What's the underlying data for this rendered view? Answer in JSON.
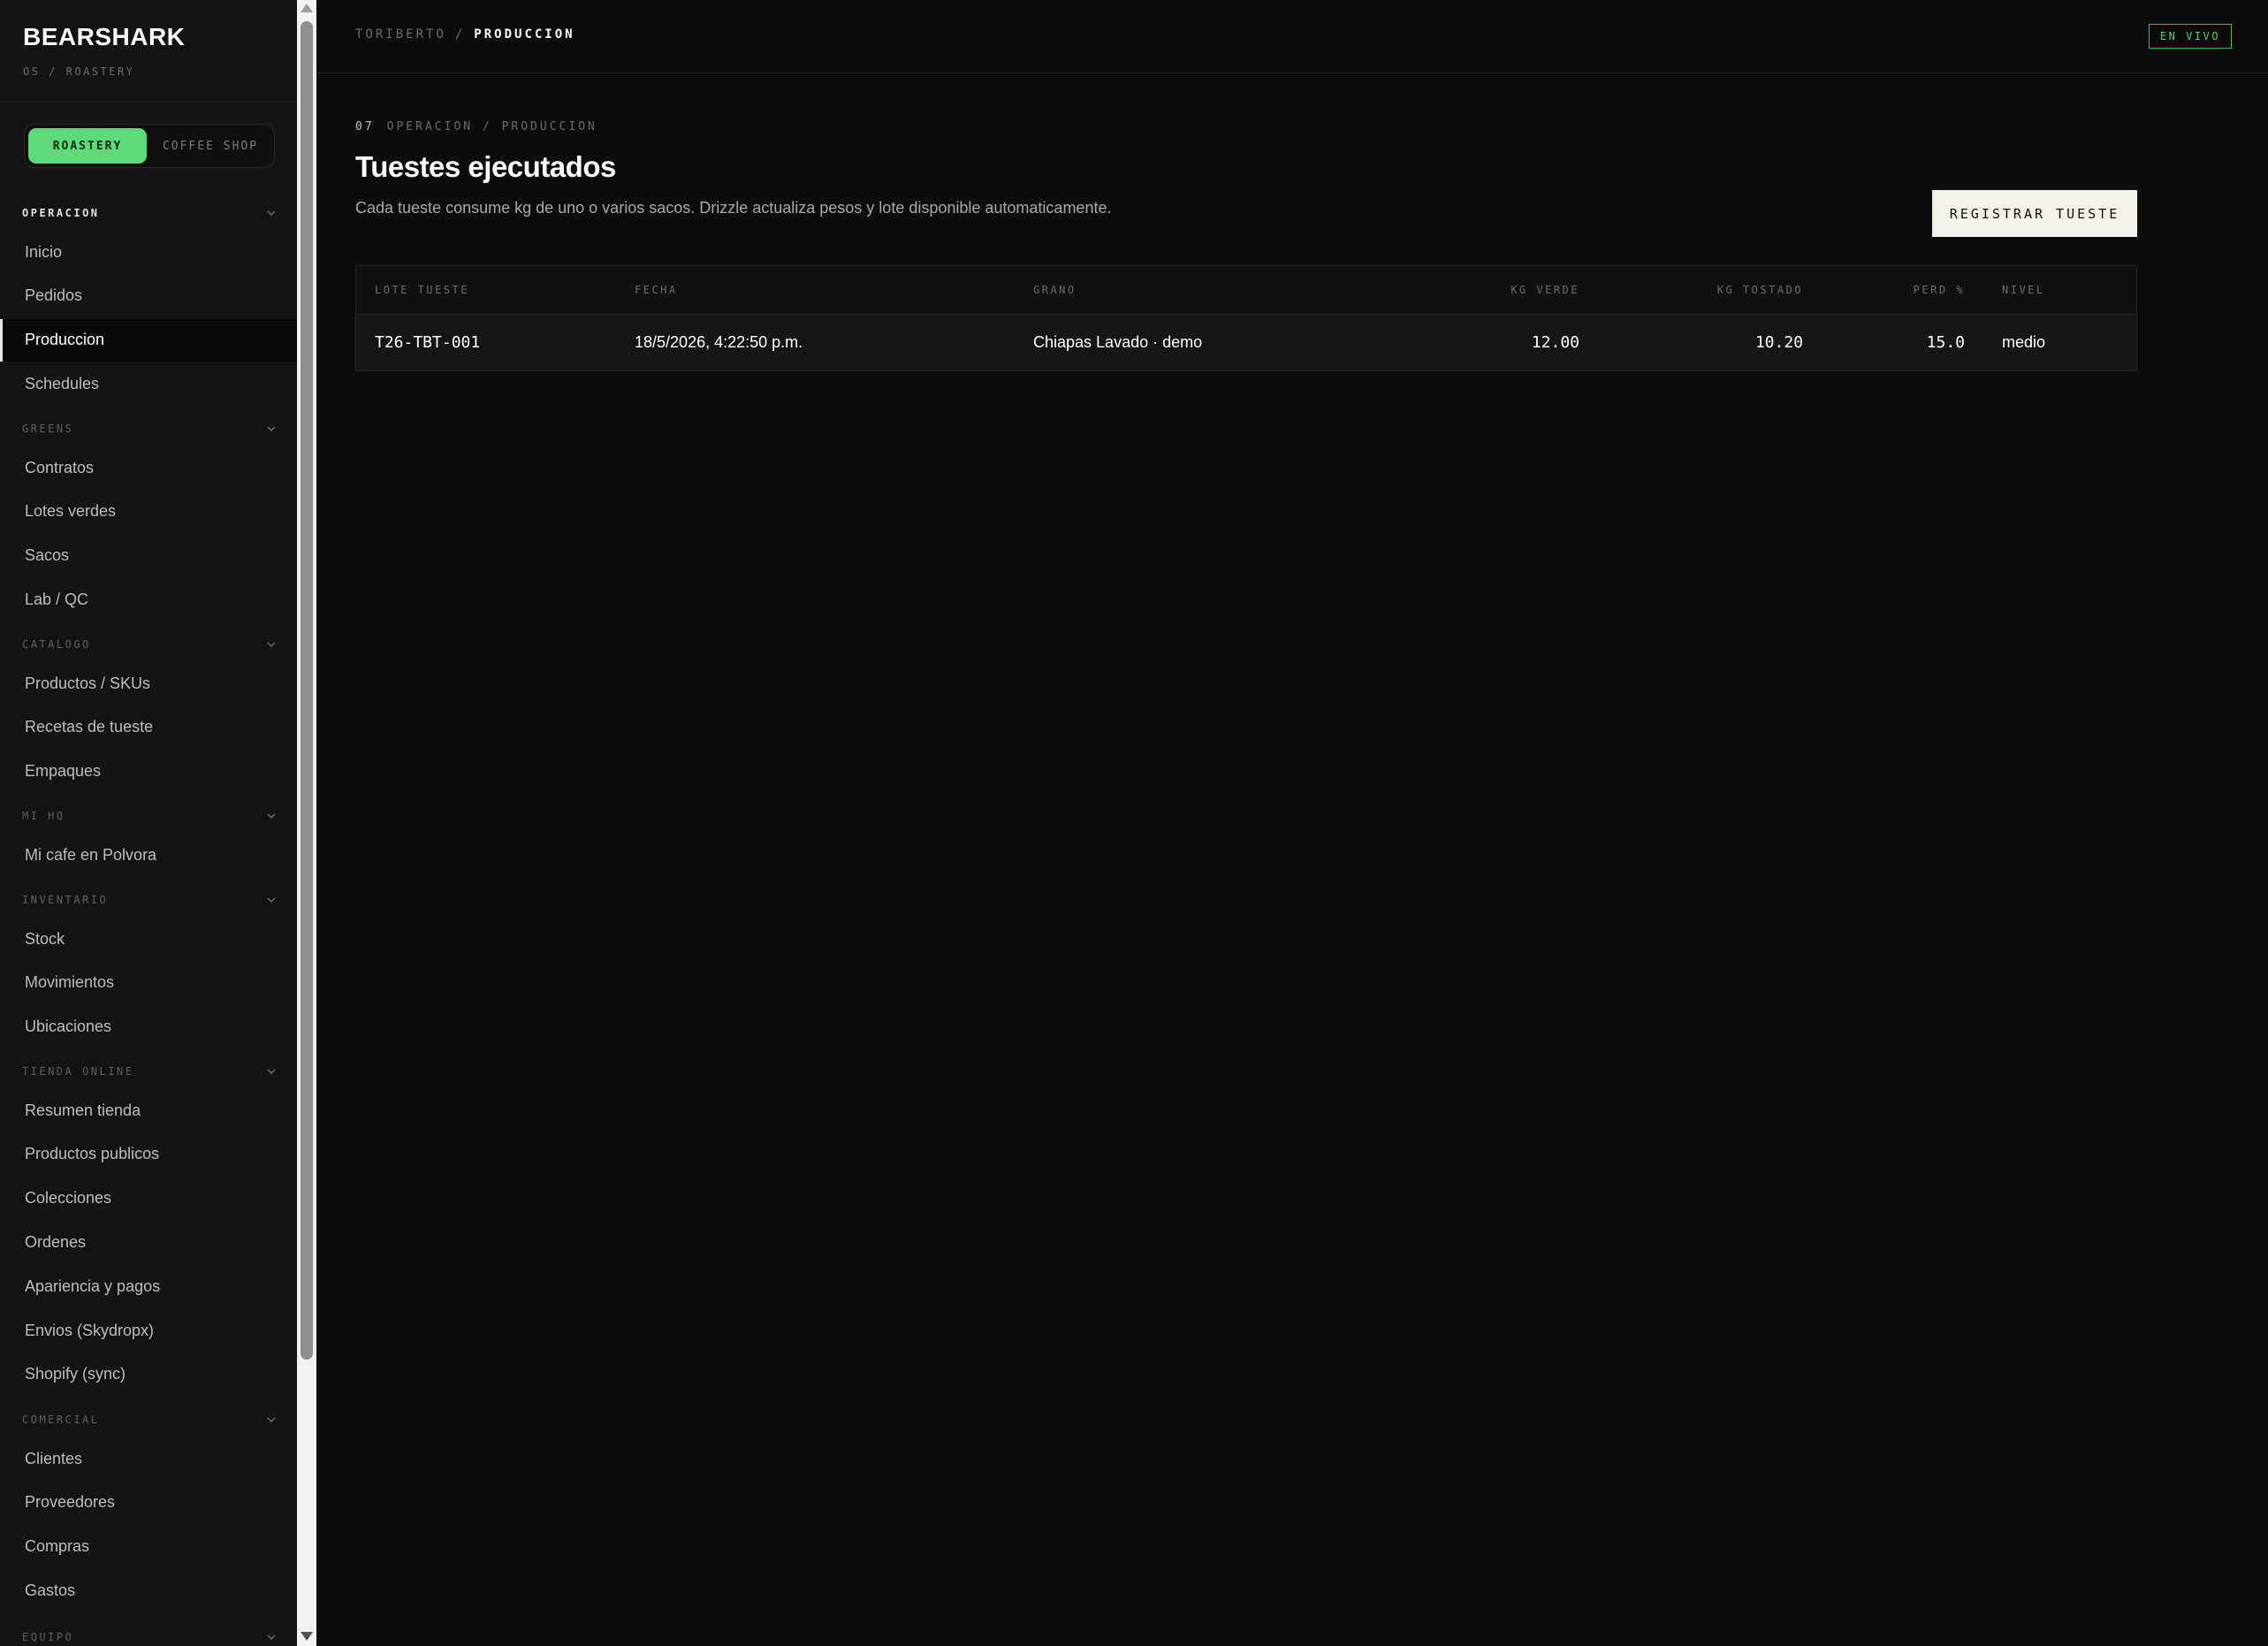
{
  "brand": {
    "name": "BEARSHARK",
    "subtitle": "OS / ROASTERY"
  },
  "mode_toggle": {
    "roastery": "ROASTERY",
    "coffee_shop": "COFFEE SHOP",
    "active": "roastery"
  },
  "sidebar": {
    "sections": [
      {
        "title": "OPERACION",
        "active": true,
        "items": [
          "Inicio",
          "Pedidos",
          "Produccion",
          "Schedules"
        ]
      },
      {
        "title": "GREENS",
        "items": [
          "Contratos",
          "Lotes verdes",
          "Sacos",
          "Lab / QC"
        ]
      },
      {
        "title": "CATALOGO",
        "items": [
          "Productos / SKUs",
          "Recetas de tueste",
          "Empaques"
        ]
      },
      {
        "title": "MI HQ",
        "items": [
          "Mi cafe en Polvora"
        ]
      },
      {
        "title": "INVENTARIO",
        "items": [
          "Stock",
          "Movimientos",
          "Ubicaciones"
        ]
      },
      {
        "title": "TIENDA ONLINE",
        "items": [
          "Resumen tienda",
          "Productos publicos",
          "Colecciones",
          "Ordenes",
          "Apariencia y pagos",
          "Envios (Skydropx)",
          "Shopify (sync)"
        ]
      },
      {
        "title": "COMERCIAL",
        "items": [
          "Clientes",
          "Proveedores",
          "Compras",
          "Gastos"
        ]
      },
      {
        "title": "EQUIPO",
        "items": []
      }
    ],
    "active_item": "Produccion"
  },
  "topbar": {
    "breadcrumb_root": "TORIBERTO",
    "breadcrumb_sep": "/",
    "breadcrumb_current": "PRODUCCION",
    "status_badge": "EN VIVO"
  },
  "page": {
    "eyebrow_num": "07",
    "eyebrow_path": "OPERACION / PRODUCCION",
    "title": "Tuestes ejecutados",
    "description": "Cada tueste consume kg de uno o varios sacos. Drizzle actualiza pesos y lote disponible automaticamente.",
    "register_button": "REGISTRAR TUESTE"
  },
  "table": {
    "columns": [
      "LOTE TUESTE",
      "FECHA",
      "GRANO",
      "KG VERDE",
      "KG TOSTADO",
      "PERD %",
      "NIVEL"
    ],
    "rows": [
      [
        "T26-TBT-001",
        "18/5/2026, 4:22:50 p.m.",
        "Chiapas Lavado · demo",
        "12.00",
        "10.20",
        "15.0",
        "medio"
      ]
    ]
  },
  "colors": {
    "accent": "#5fd97a",
    "live": "#4fd074",
    "background": "#0d0d0d",
    "sidebar": "#141414"
  }
}
